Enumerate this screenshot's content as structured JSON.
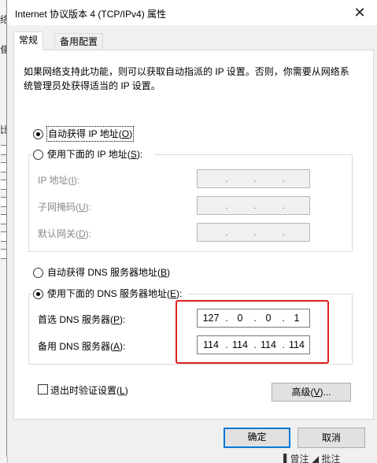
{
  "window": {
    "title": "Internet 协议版本 4 (TCP/IPv4) 属性",
    "close_glyph": "✕"
  },
  "tabs": [
    {
      "label": "常规"
    },
    {
      "label": "备用配置"
    }
  ],
  "description": "如果网络支持此功能，则可以获取自动指派的 IP 设置。否则，你需要从网络系统管理员处获得适当的 IP 设置。",
  "ip_section": {
    "auto_label": "自动获得 IP 地址(O)",
    "auto_label_parts": [
      "自动获得 IP 地址(",
      "O",
      ")"
    ],
    "manual_label_parts": [
      "使用下面的 IP 地址(",
      "S",
      "):"
    ],
    "fields": [
      {
        "label_parts": [
          "IP 地址(",
          "I",
          "):"
        ],
        "octets": [
          "",
          "",
          "",
          ""
        ]
      },
      {
        "label_parts": [
          "子网掩码(",
          "U",
          "):"
        ],
        "octets": [
          "",
          "",
          "",
          ""
        ]
      },
      {
        "label_parts": [
          "默认网关(",
          "D",
          "):"
        ],
        "octets": [
          "",
          "",
          "",
          ""
        ]
      }
    ],
    "selected": "auto"
  },
  "dns_section": {
    "auto_label_parts": [
      "自动获得 DNS 服务器地址(",
      "B",
      ")"
    ],
    "manual_label_parts": [
      "使用下面的 DNS 服务器地址(",
      "E",
      "):"
    ],
    "selected": "manual",
    "preferred": {
      "label_parts": [
        "首选 DNS 服务器(",
        "P",
        "):"
      ],
      "octets": [
        "127",
        "0",
        "0",
        "1"
      ]
    },
    "alternate": {
      "label_parts": [
        "备用 DNS 服务器(",
        "A",
        "):"
      ],
      "octets": [
        "114",
        "114",
        "114",
        "114"
      ]
    }
  },
  "validate_checkbox": {
    "label_parts": [
      "退出时验证设置(",
      "L",
      ")"
    ],
    "checked": false
  },
  "advanced_button_parts": [
    "高级(",
    "V",
    ")..."
  ],
  "ok_button": "确定",
  "cancel_button": "取消",
  "annotation_color": "#e0201d",
  "accent_color": "#0078d7",
  "behind_window": {
    "left_chars": [
      "络",
      "隹",
      "比"
    ],
    "bottom_text": "▌曾注  ◢ 批注"
  }
}
